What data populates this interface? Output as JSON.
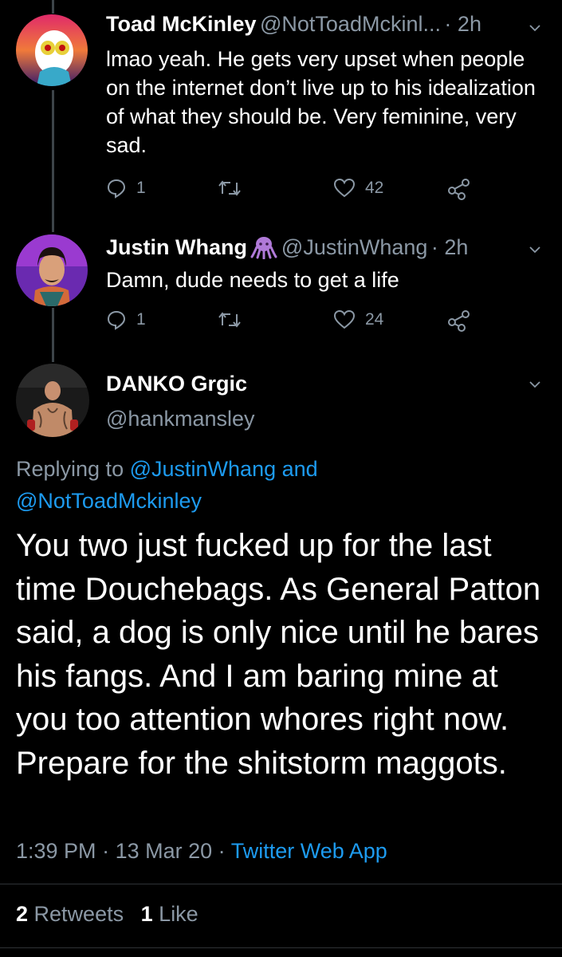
{
  "tweets": [
    {
      "name": "Toad McKinley",
      "handle": "@NotToadMckinl...",
      "time": "2h",
      "text": "lmao yeah. He gets very upset when people on the internet don’t live up to his idealization of what they should be. Very feminine, very sad.",
      "replies": "1",
      "likes": "42"
    },
    {
      "name": "Justin Whang",
      "handle": "@JustinWhang",
      "time": "2h",
      "text": "Damn, dude needs to get a life",
      "replies": "1",
      "likes": "24"
    }
  ],
  "main": {
    "name": "DANKO Grgic",
    "handle": "@hankmansley",
    "replying_prefix": "Replying to",
    "reply_to_1": "@JustinWhang",
    "reply_and": "and",
    "reply_to_2": "@NotToadMckinley",
    "text": "You two just fucked up for the last time Douchebags. As General Patton said, a dog is only nice until he bares his fangs. And I am baring mine at you too attention whores right now. Prepare for the shitstorm maggots.",
    "time": "1:39 PM",
    "date": "13 Mar 20",
    "source": "Twitter Web App",
    "retweets_count": "2",
    "retweets_label": "Retweets",
    "likes_count": "1",
    "likes_label": "Like"
  },
  "colors": {
    "background": "#000000",
    "secondary": "#8b98a5",
    "link": "#1d9bf0",
    "thread_line": "#3d4449"
  }
}
